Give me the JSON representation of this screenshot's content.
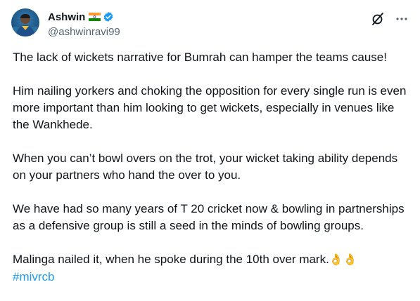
{
  "author": {
    "display_name": "Ashwin",
    "handle": "@ashwinravi99"
  },
  "tweet": {
    "paragraphs": [
      "The lack of wickets narrative for Bumrah can hamper the teams cause!",
      "Him nailing yorkers and choking the opposition for every single run is even more important than him looking to get wickets, especially in venues like the Wankhede.",
      "When you can’t bowl overs on the trot, your wicket taking ability depends on your partners who hand the over to you.",
      "We have had so many years of  T 20 cricket now & bowling in partnerships as a defensive group is still a seed in the minds of bowling groups."
    ],
    "final_line": "Malinga nailed it, when he spoke during the 10th over mark.",
    "emoji": "👌👌",
    "hashtag": "#mivrcb"
  },
  "colors": {
    "text": "#0f1419",
    "secondary": "#536471",
    "link": "#1d9bf0",
    "verified": "#1d9bf0"
  },
  "icons": {
    "flag": "india-flag-icon",
    "verified": "verified-badge-icon",
    "grok": "grok-icon",
    "more": "more-options-icon"
  }
}
